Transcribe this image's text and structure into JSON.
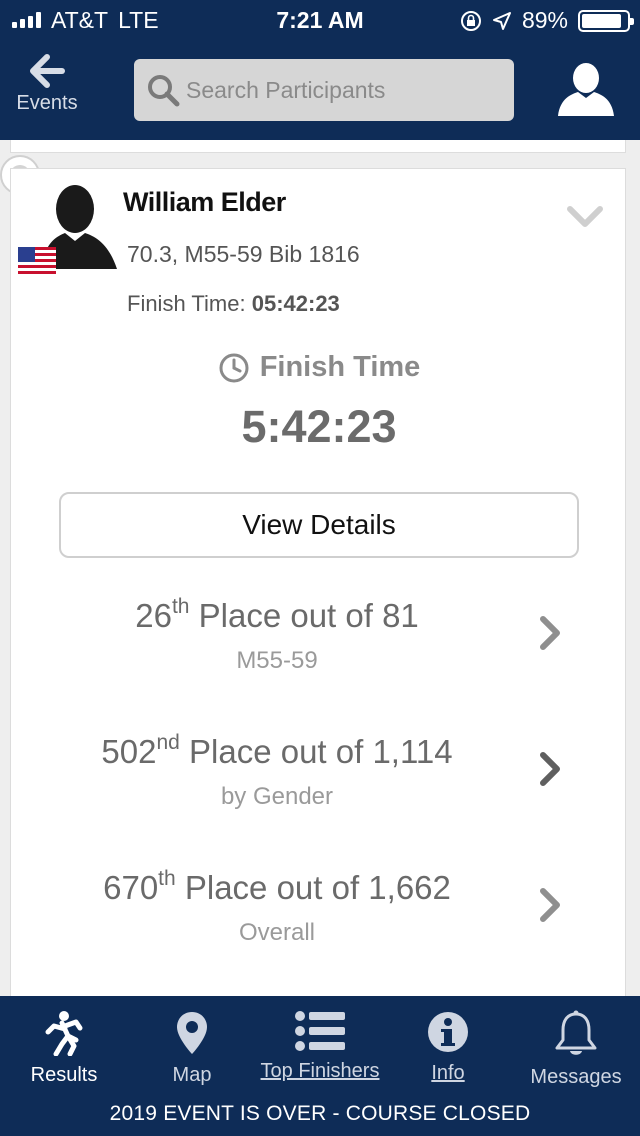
{
  "status_bar": {
    "carrier": "AT&T",
    "network": "LTE",
    "time": "7:21 AM",
    "battery_percent": "89%",
    "battery_level": 0.89,
    "icons": [
      "signal-icon",
      "rotation-lock-icon",
      "location-icon",
      "battery-icon"
    ]
  },
  "nav": {
    "back_label": "Events",
    "search_placeholder": "Search Participants",
    "search_value": "",
    "icons": [
      "back-arrow-icon",
      "search-icon",
      "profile-icon"
    ]
  },
  "participant": {
    "name": "William Elder",
    "meta": "70.3, M55-59 Bib 1816",
    "finish_label": "Finish Time:",
    "finish_time": "05:42:23",
    "flag": "us-flag-icon"
  },
  "finish": {
    "heading": "Finish Time",
    "value": "5:42:23",
    "icon": "clock-icon"
  },
  "view_details_label": "View Details",
  "placements": [
    {
      "rank": "26",
      "suffix": "th",
      "text": "Place out of 81",
      "sub": "M55-59"
    },
    {
      "rank": "502",
      "suffix": "nd",
      "text": "Place out of 1,114",
      "sub": "by Gender"
    },
    {
      "rank": "670",
      "suffix": "th",
      "text": "Place out of 1,662",
      "sub": "Overall"
    }
  ],
  "tabs": [
    {
      "label": "Results",
      "icon": "runner-icon",
      "active": true
    },
    {
      "label": "Map",
      "icon": "map-pin-icon"
    },
    {
      "label": "Top Finishers",
      "icon": "list-icon"
    },
    {
      "label": "Info",
      "icon": "info-icon"
    },
    {
      "label": "Messages",
      "icon": "bell-icon"
    }
  ],
  "banner": "2019 EVENT IS OVER - COURSE CLOSED",
  "colors": {
    "header_bg": "#0e2c57",
    "tabbar_bg": "#0e2c57",
    "accent_gray": "#6b6b6b"
  }
}
